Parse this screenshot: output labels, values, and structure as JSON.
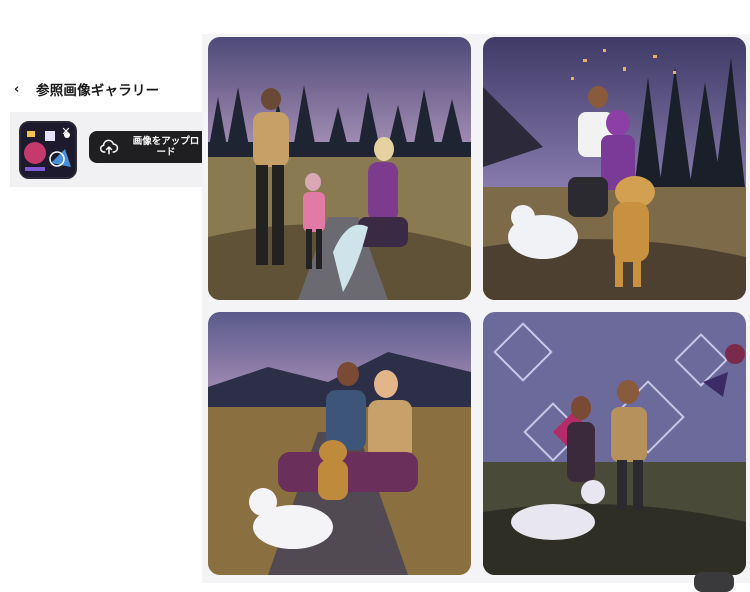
{
  "panel": {
    "back_label": "参照画像ギャラリー",
    "upload_label": "画像をアップロード"
  },
  "icons": {
    "back": "chevron-left-icon",
    "upload": "cloud-upload-icon",
    "close": "close-icon"
  },
  "gallery": {
    "images": [
      "family-forest-dusk",
      "couple-dog-cat-forest",
      "couple-dog-cat-field",
      "couple-geometric-sky"
    ]
  },
  "colors": {
    "upload_button_bg": "#1f1f21",
    "gallery_bg": "#f4f4f6",
    "accent_purple": "#7a4a9a"
  }
}
